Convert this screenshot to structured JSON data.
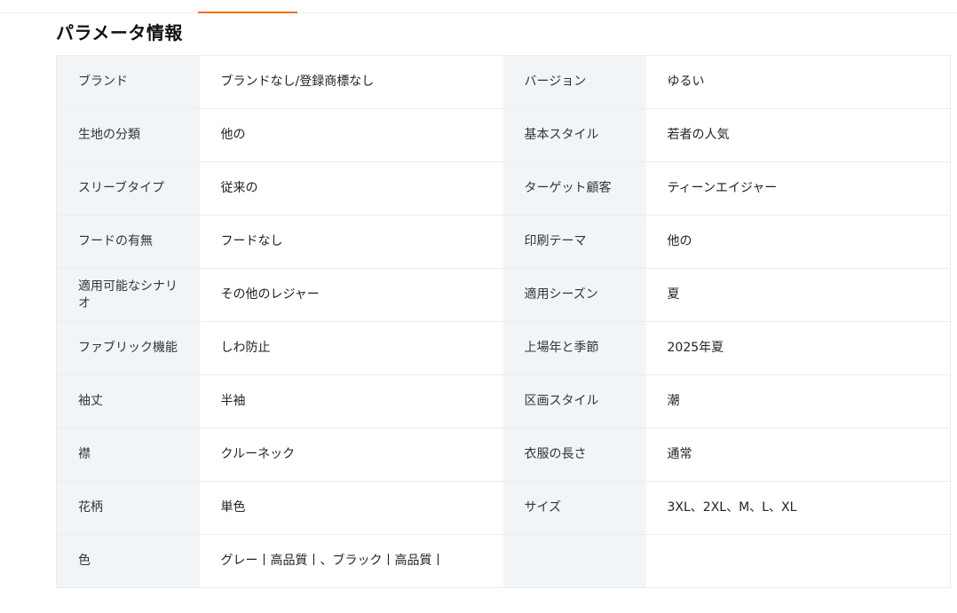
{
  "section": {
    "title": "パラメータ情報"
  },
  "accent_color": "#ff6a00",
  "rows": [
    [
      {
        "label": "ブランド",
        "value": "ブランドなし/登録商標なし"
      },
      {
        "label": "バージョン",
        "value": "ゆるい"
      }
    ],
    [
      {
        "label": "生地の分類",
        "value": "他の"
      },
      {
        "label": "基本スタイル",
        "value": "若者の人気"
      }
    ],
    [
      {
        "label": "スリーブタイプ",
        "value": "従来の"
      },
      {
        "label": "ターゲット顧客",
        "value": "ティーンエイジャー"
      }
    ],
    [
      {
        "label": "フードの有無",
        "value": "フードなし"
      },
      {
        "label": "印刷テーマ",
        "value": "他の"
      }
    ],
    [
      {
        "label": "適用可能なシナリオ",
        "value": "その他のレジャー"
      },
      {
        "label": "適用シーズン",
        "value": "夏"
      }
    ],
    [
      {
        "label": "ファブリック機能",
        "value": "しわ防止"
      },
      {
        "label": "上場年と季節",
        "value": "2025年夏"
      }
    ],
    [
      {
        "label": "袖丈",
        "value": "半袖"
      },
      {
        "label": "区画スタイル",
        "value": "潮"
      }
    ],
    [
      {
        "label": "襟",
        "value": "クルーネック"
      },
      {
        "label": "衣服の長さ",
        "value": "通常"
      }
    ],
    [
      {
        "label": "花柄",
        "value": "単色"
      },
      {
        "label": "サイズ",
        "value": "3XL、2XL、M、L、XL"
      }
    ],
    [
      {
        "label": "色",
        "value": "グレー丨高品質丨、ブラック丨高品質丨"
      },
      {
        "label": "",
        "value": ""
      }
    ]
  ]
}
